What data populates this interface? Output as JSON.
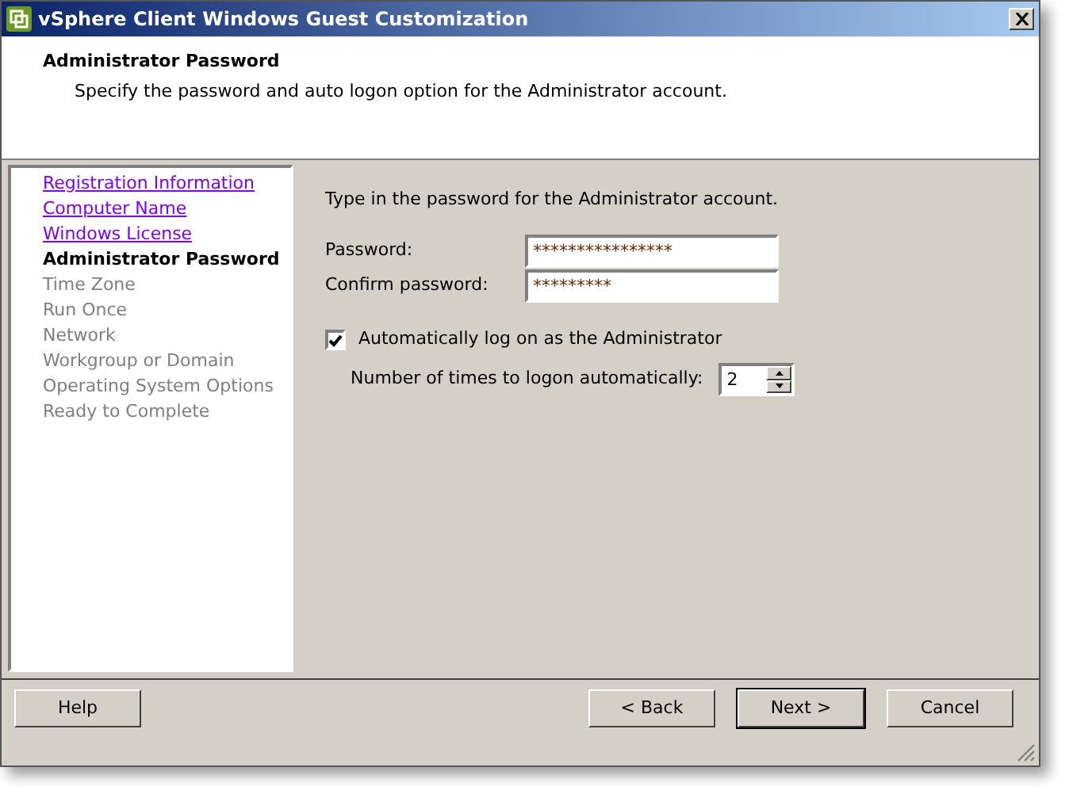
{
  "window": {
    "title": "vSphere Client Windows Guest Customization"
  },
  "header": {
    "title": "Administrator Password",
    "subtitle": "Specify the password and auto logon option for the Administrator account."
  },
  "steps": [
    {
      "label": "Registration Information",
      "kind": "visited"
    },
    {
      "label": "Computer Name",
      "kind": "visited"
    },
    {
      "label": "Windows License",
      "kind": "visited"
    },
    {
      "label": "Administrator Password",
      "kind": "current"
    },
    {
      "label": "Time Zone",
      "kind": "pending"
    },
    {
      "label": "Run Once",
      "kind": "pending"
    },
    {
      "label": "Network",
      "kind": "pending"
    },
    {
      "label": "Workgroup or Domain",
      "kind": "pending"
    },
    {
      "label": "Operating System Options",
      "kind": "pending"
    },
    {
      "label": "Ready to Complete",
      "kind": "pending"
    }
  ],
  "form": {
    "intro": "Type in the password for the Administrator account.",
    "fields": [
      {
        "label": "Password:",
        "value": "****************"
      },
      {
        "label": "Confirm password:",
        "value": "*********"
      }
    ],
    "auto_logon": {
      "label": "Automatically log on as the Administrator",
      "checked": true
    },
    "logon_count": {
      "label": "Number of times to logon automatically:",
      "value": "2"
    }
  },
  "buttons": [
    {
      "label": "Help",
      "default": false
    },
    {
      "label": "< Back",
      "default": false
    },
    {
      "label": "Next >",
      "default": true
    },
    {
      "label": "Cancel",
      "default": false
    }
  ]
}
